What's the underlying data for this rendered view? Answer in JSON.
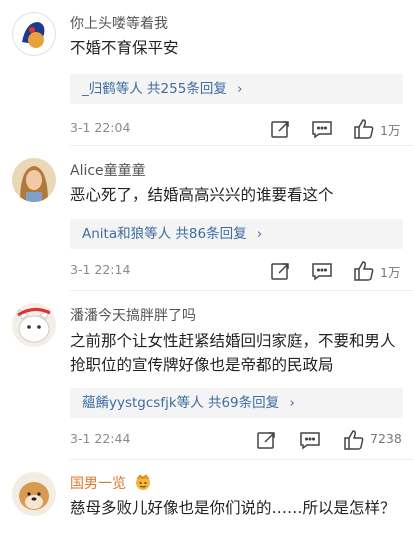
{
  "comments": [
    {
      "username": "你上头喽等着我",
      "text": "不婚不育保平安",
      "reply_names": "_归鹤等人",
      "reply_count": "共255条回复",
      "reply_chevron": "›",
      "time": "3-1 22:04",
      "likes": "1万"
    },
    {
      "username": "Alice童童童",
      "text": "恶心死了，结婚高高兴兴的谁要看这个",
      "reply_names": "Anita和狼等人",
      "reply_count": "共86条回复",
      "reply_chevron": "›",
      "time": "3-1 22:14",
      "likes": "1万"
    },
    {
      "username": "潘潘今天搞胖胖了吗",
      "text": "之前那个让女性赶紧结婚回归家庭，不要和男人抢职位的宣传牌好像也是帝都的民政局",
      "reply_names": "蘊餚yystgcsfjk等人",
      "reply_count": "共69条回复",
      "reply_chevron": "›",
      "time": "3-1 22:44",
      "likes": "7238"
    },
    {
      "username": "国男一览",
      "text": "慈母多败儿好像也是你们说的……所以是怎样？"
    }
  ],
  "icons": {
    "share": "share-icon",
    "comment": "comment-icon",
    "like": "thumbs-up-icon",
    "badge": "emoji-badge-icon"
  },
  "colors": {
    "link_blue": "#3d6da1",
    "orange_username": "#e0752a",
    "reply_bg": "#f4f4f4",
    "meta_gray": "#8a8a8a"
  }
}
